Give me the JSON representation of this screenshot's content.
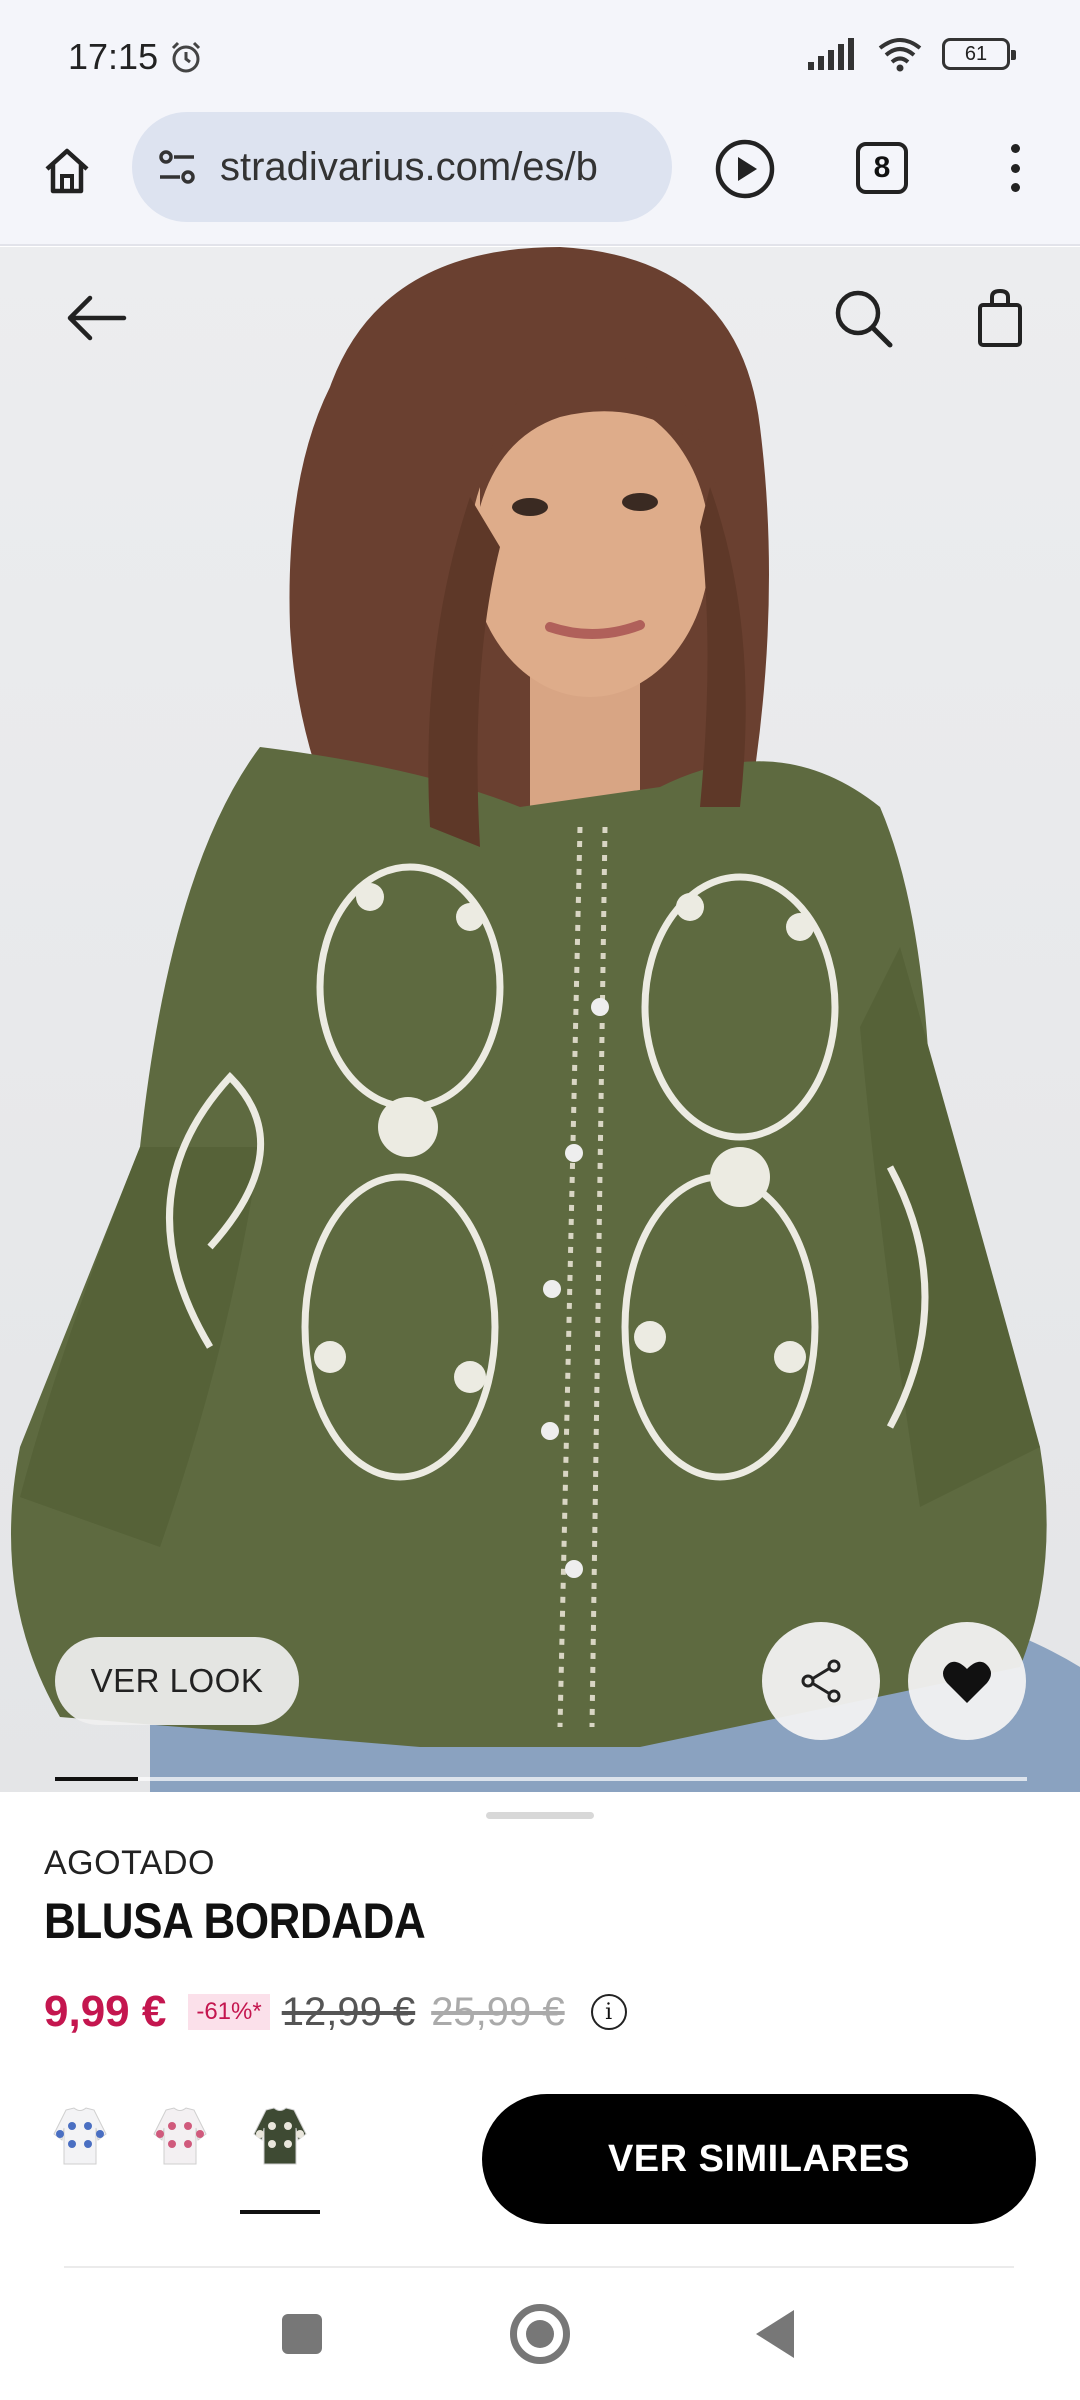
{
  "status_bar": {
    "time": "17:15",
    "battery": "61"
  },
  "browser": {
    "url": "stradivarius.com/es/b",
    "tab_count": "8"
  },
  "product": {
    "image_alt": "Blusa bordada verde",
    "ver_look": "VER LOOK",
    "carousel_progress": 0.085,
    "availability": "AGOTADO",
    "title": "BLUSA BORDADA",
    "price_current": "9,99 €",
    "discount": "-61%*",
    "price_previous": "12,99 €",
    "price_original": "25,99 €",
    "info": "i",
    "cta": "VER SIMILARES",
    "swatches": [
      {
        "name": "white-blue",
        "colors": [
          "#f3f3f5",
          "#4a6fc2"
        ]
      },
      {
        "name": "white-pink",
        "colors": [
          "#f3f0f2",
          "#d05a7c"
        ]
      },
      {
        "name": "olive",
        "colors": [
          "#3e4a33",
          "#e9e6dc"
        ],
        "selected": true
      }
    ]
  },
  "colors": {
    "accent_price": "#c4164f",
    "discount_bg": "#fbe0ea",
    "blouse": "#5e6a40",
    "cta_bg": "#000000"
  }
}
